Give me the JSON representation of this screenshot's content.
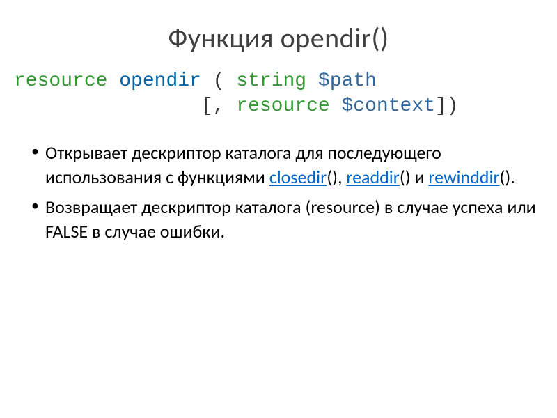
{
  "title": "Функция opendir()",
  "signature": {
    "ret": "resource",
    "name": "opendir",
    "paren_open": " ( ",
    "arg1_type": "string",
    "arg1_name": "$path",
    "line2_indent": "                [, ",
    "arg2_type": "resource",
    "arg2_name": "$context",
    "close": "])"
  },
  "bullets": {
    "b1_before": "Открывает дескриптор каталога для последующего использования с функциями ",
    "b1_link1": "closedir",
    "b1_paren1": "()",
    "b1_mid1": ",  ",
    "b1_link2": "readdir",
    "b1_paren2": "()",
    "b1_mid2": " и ",
    "b1_link3": "rewinddir",
    "b1_paren3": "()",
    "b1_end": ".",
    "b2": "Возвращает дескриптор каталога (resource) в случае успеха или FALSE в случае ошибки."
  }
}
